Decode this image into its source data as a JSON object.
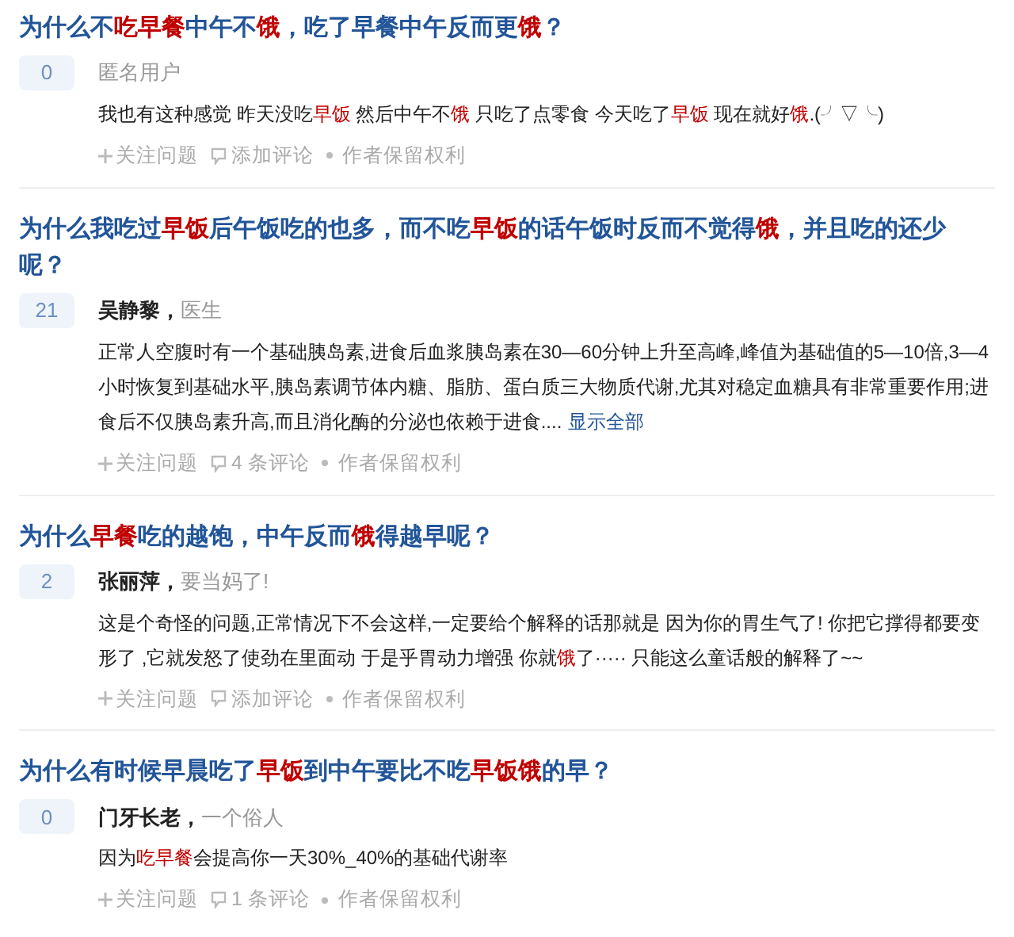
{
  "questions": [
    {
      "title": [
        {
          "text": "为什么不",
          "highlight": false
        },
        {
          "text": "吃早餐",
          "highlight": true
        },
        {
          "text": "中午不",
          "highlight": false
        },
        {
          "text": "饿",
          "highlight": true
        },
        {
          "text": "，吃了早餐中午反而更",
          "highlight": false
        },
        {
          "text": "饿",
          "highlight": true
        },
        {
          "text": "？",
          "highlight": false
        }
      ],
      "votes": "0",
      "author": {
        "kind": "anonymous",
        "name": "匿名用户"
      },
      "body": [
        {
          "text": "我也有这种感觉 昨天没吃",
          "highlight": false
        },
        {
          "text": "早饭",
          "highlight": true
        },
        {
          "text": " 然后中午不",
          "highlight": false
        },
        {
          "text": "饿",
          "highlight": true
        },
        {
          "text": " 只吃了点零食 今天吃了",
          "highlight": false
        },
        {
          "text": "早饭",
          "highlight": true
        },
        {
          "text": " 现在就好",
          "highlight": false
        },
        {
          "text": "饿",
          "highlight": true
        },
        {
          "text": ".(╯▽╰)",
          "highlight": false
        }
      ],
      "actions": {
        "follow": "关注问题",
        "comment": "添加评论",
        "rights": "作者保留权利"
      }
    },
    {
      "title": [
        {
          "text": "为什么我吃过",
          "highlight": false
        },
        {
          "text": "早饭",
          "highlight": true
        },
        {
          "text": "后午饭吃的也多，而不吃",
          "highlight": false
        },
        {
          "text": "早饭",
          "highlight": true
        },
        {
          "text": "的话午饭时反而不觉得",
          "highlight": false
        },
        {
          "text": "饿",
          "highlight": true
        },
        {
          "text": "，并且吃的还少呢？",
          "highlight": false
        }
      ],
      "votes": "21",
      "author": {
        "kind": "named",
        "name": "吴静黎，",
        "bio": "医生"
      },
      "body": [
        {
          "text": "正常人空腹时有一个基础胰岛素,进食后血浆胰岛素在30—60分钟上升至高峰,峰值为基础值的5—10倍,3—4小时恢复到基础水平,胰岛素调节体内糖、脂肪、蛋白质三大物质代谢,尤其对稳定血糖具有非常重要作用;进食后不仅胰岛素升高,而且消化酶的分泌也依赖于进食....",
          "highlight": false
        }
      ],
      "more_link": "显示全部",
      "actions": {
        "follow": "关注问题",
        "comment": "4 条评论",
        "rights": "作者保留权利"
      }
    },
    {
      "title": [
        {
          "text": "为什么",
          "highlight": false
        },
        {
          "text": "早餐",
          "highlight": true
        },
        {
          "text": "吃的越饱，中午反而",
          "highlight": false
        },
        {
          "text": "饿",
          "highlight": true
        },
        {
          "text": "得越早呢？",
          "highlight": false
        }
      ],
      "votes": "2",
      "author": {
        "kind": "named",
        "name": "张丽萍，",
        "bio": "要当妈了!"
      },
      "body": [
        {
          "text": "这是个奇怪的问题,正常情况下不会这样,一定要给个解释的话那就是 因为你的胃生气了! 你把它撑得都要变形了 ,它就发怒了使劲在里面动 于是乎胃动力增强 你就",
          "highlight": false
        },
        {
          "text": "饿",
          "highlight": true
        },
        {
          "text": "了····· 只能这么童话般的解释了~~",
          "highlight": false
        }
      ],
      "actions": {
        "follow": "关注问题",
        "comment": "添加评论",
        "rights": "作者保留权利"
      }
    },
    {
      "title": [
        {
          "text": "为什么有时候早晨吃了",
          "highlight": false
        },
        {
          "text": "早饭",
          "highlight": true
        },
        {
          "text": "到中午要比不吃",
          "highlight": false
        },
        {
          "text": "早饭饿",
          "highlight": true
        },
        {
          "text": "的早？",
          "highlight": false
        }
      ],
      "votes": "0",
      "author": {
        "kind": "named",
        "name": "门牙长老，",
        "bio": "一个俗人"
      },
      "body": [
        {
          "text": "因为",
          "highlight": false
        },
        {
          "text": "吃早餐",
          "highlight": true
        },
        {
          "text": "会提高你一天30%_40%的基础代谢率",
          "highlight": false
        }
      ],
      "actions": {
        "follow": "关注问题",
        "comment": "1 条评论",
        "rights": "作者保留权利"
      }
    }
  ]
}
